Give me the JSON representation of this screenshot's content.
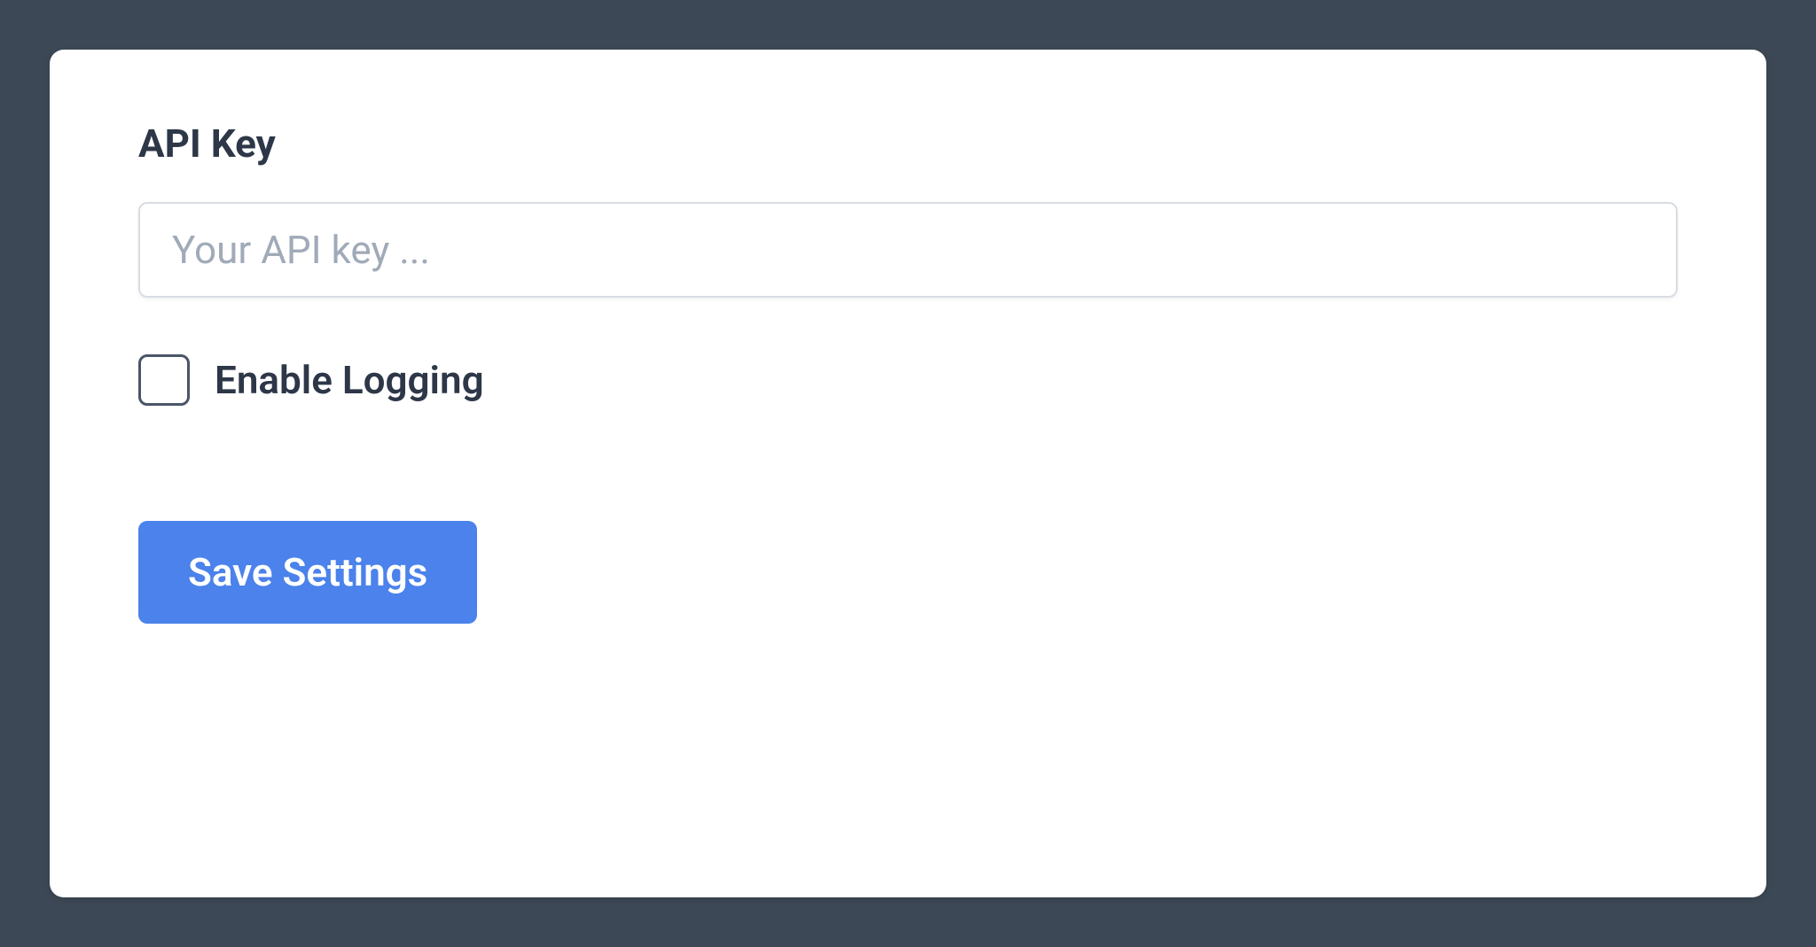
{
  "form": {
    "api_key_label": "API Key",
    "api_key_placeholder": "Your API key ...",
    "api_key_value": "",
    "enable_logging_label": "Enable Logging",
    "enable_logging_checked": false,
    "save_button_label": "Save Settings"
  }
}
